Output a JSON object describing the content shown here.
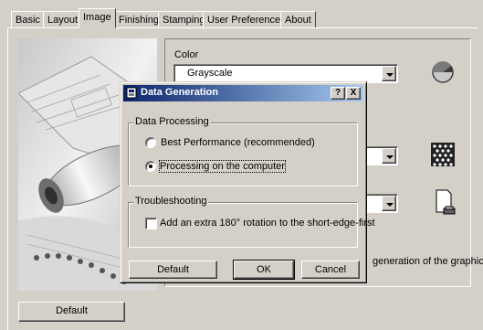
{
  "tabs": [
    "Basic",
    "Layout",
    "Image",
    "Finishing",
    "Stamping",
    "User Preferences",
    "About"
  ],
  "active_tab": "Image",
  "image_panel": {
    "color_label": "Color",
    "color_value": "Grayscale",
    "default_button": "Default",
    "hidden_text": "generation of the graphical"
  },
  "dialog": {
    "title": "Data Generation",
    "help_btn": "?",
    "close_btn": "X",
    "data_processing": {
      "label": "Data Processing",
      "options": [
        "Best Performance (recommended)",
        "Processing on the computer"
      ],
      "selected": 1
    },
    "troubleshooting": {
      "label": "Troubleshooting",
      "checkbox_label": "Add an extra 180° rotation to the short-edge-first",
      "checked": false
    },
    "buttons": {
      "default": "Default",
      "ok": "OK",
      "cancel": "Cancel"
    }
  },
  "icons": [
    "grayscale-icon",
    "halftone-pattern-icon",
    "printer-page-icon",
    "dialog-app-icon"
  ]
}
